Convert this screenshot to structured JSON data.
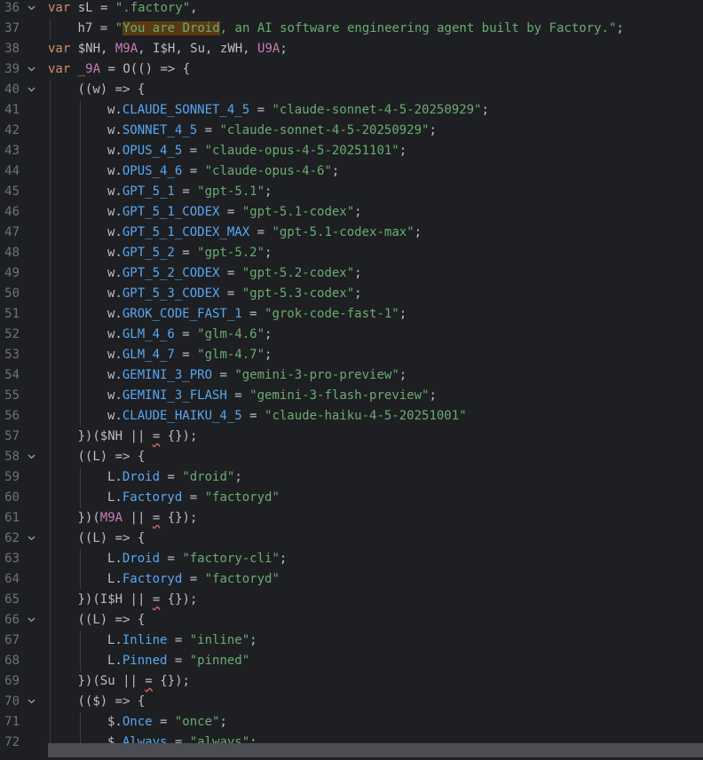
{
  "editor": {
    "language": "javascript",
    "theme_colors": {
      "background": "#1e1f22",
      "line_number": "#6f737a",
      "keyword": "#cf8e6d",
      "plain": "#bcbec4",
      "string": "#6aab73",
      "property": "#56a8f5",
      "variable": "#c77dbb",
      "search_highlight": "#5a3a11"
    },
    "lines": [
      {
        "number": "36",
        "fold": true,
        "indent": 0,
        "tokens": [
          [
            "var",
            "keyword"
          ],
          [
            " sL = ",
            "plain"
          ],
          [
            "\".factory\"",
            "string"
          ],
          [
            ",",
            "plain"
          ]
        ]
      },
      {
        "number": "37",
        "fold": false,
        "indent": 1,
        "tokens": [
          [
            "h7 = ",
            "plain"
          ],
          [
            "\"",
            "string"
          ],
          [
            "You are Droid",
            "string",
            "highlight"
          ],
          [
            ", an AI software engineering agent built by Factory.\"",
            "string"
          ],
          [
            ";",
            "plain"
          ]
        ]
      },
      {
        "number": "38",
        "fold": false,
        "indent": 0,
        "tokens": [
          [
            "var",
            "keyword"
          ],
          [
            " $NH, ",
            "plain"
          ],
          [
            "M9A",
            "var"
          ],
          [
            ", I$H, Su, zWH, ",
            "plain"
          ],
          [
            "U9A",
            "var"
          ],
          [
            ";",
            "plain"
          ]
        ]
      },
      {
        "number": "39",
        "fold": true,
        "indent": 0,
        "tokens": [
          [
            "var",
            "keyword"
          ],
          [
            " ",
            "plain"
          ],
          [
            "_9A",
            "var"
          ],
          [
            " = O(() => {",
            "plain"
          ]
        ]
      },
      {
        "number": "40",
        "fold": true,
        "indent": 1,
        "tokens": [
          [
            "((w) => {",
            "plain"
          ]
        ]
      },
      {
        "number": "41",
        "fold": false,
        "indent": 2,
        "tokens": [
          [
            "w.",
            "plain"
          ],
          [
            "CLAUDE_SONNET_4_5",
            "prop"
          ],
          [
            " = ",
            "plain"
          ],
          [
            "\"claude-sonnet-4-5-20250929\"",
            "string"
          ],
          [
            ";",
            "plain"
          ]
        ]
      },
      {
        "number": "42",
        "fold": false,
        "indent": 2,
        "tokens": [
          [
            "w.",
            "plain"
          ],
          [
            "SONNET_4_5",
            "prop"
          ],
          [
            " = ",
            "plain"
          ],
          [
            "\"claude-sonnet-4-5-20250929\"",
            "string"
          ],
          [
            ";",
            "plain"
          ]
        ]
      },
      {
        "number": "43",
        "fold": false,
        "indent": 2,
        "tokens": [
          [
            "w.",
            "plain"
          ],
          [
            "OPUS_4_5",
            "prop"
          ],
          [
            " = ",
            "plain"
          ],
          [
            "\"claude-opus-4-5-20251101\"",
            "string"
          ],
          [
            ";",
            "plain"
          ]
        ]
      },
      {
        "number": "44",
        "fold": false,
        "indent": 2,
        "tokens": [
          [
            "w.",
            "plain"
          ],
          [
            "OPUS_4_6",
            "prop"
          ],
          [
            " = ",
            "plain"
          ],
          [
            "\"claude-opus-4-6\"",
            "string"
          ],
          [
            ";",
            "plain"
          ]
        ]
      },
      {
        "number": "45",
        "fold": false,
        "indent": 2,
        "tokens": [
          [
            "w.",
            "plain"
          ],
          [
            "GPT_5_1",
            "prop"
          ],
          [
            " = ",
            "plain"
          ],
          [
            "\"gpt-5.1\"",
            "string"
          ],
          [
            ";",
            "plain"
          ]
        ]
      },
      {
        "number": "46",
        "fold": false,
        "indent": 2,
        "tokens": [
          [
            "w.",
            "plain"
          ],
          [
            "GPT_5_1_CODEX",
            "prop"
          ],
          [
            " = ",
            "plain"
          ],
          [
            "\"gpt-5.1-codex\"",
            "string"
          ],
          [
            ";",
            "plain"
          ]
        ]
      },
      {
        "number": "47",
        "fold": false,
        "indent": 2,
        "tokens": [
          [
            "w.",
            "plain"
          ],
          [
            "GPT_5_1_CODEX_MAX",
            "prop"
          ],
          [
            " = ",
            "plain"
          ],
          [
            "\"gpt-5.1-codex-max\"",
            "string"
          ],
          [
            ";",
            "plain"
          ]
        ]
      },
      {
        "number": "48",
        "fold": false,
        "indent": 2,
        "tokens": [
          [
            "w.",
            "plain"
          ],
          [
            "GPT_5_2",
            "prop"
          ],
          [
            " = ",
            "plain"
          ],
          [
            "\"gpt-5.2\"",
            "string"
          ],
          [
            ";",
            "plain"
          ]
        ]
      },
      {
        "number": "49",
        "fold": false,
        "indent": 2,
        "tokens": [
          [
            "w.",
            "plain"
          ],
          [
            "GPT_5_2_CODEX",
            "prop"
          ],
          [
            " = ",
            "plain"
          ],
          [
            "\"gpt-5.2-codex\"",
            "string"
          ],
          [
            ";",
            "plain"
          ]
        ]
      },
      {
        "number": "50",
        "fold": false,
        "indent": 2,
        "tokens": [
          [
            "w.",
            "plain"
          ],
          [
            "GPT_5_3_CODEX",
            "prop"
          ],
          [
            " = ",
            "plain"
          ],
          [
            "\"gpt-5.3-codex\"",
            "string"
          ],
          [
            ";",
            "plain"
          ]
        ]
      },
      {
        "number": "51",
        "fold": false,
        "indent": 2,
        "tokens": [
          [
            "w.",
            "plain"
          ],
          [
            "GROK_CODE_FAST_1",
            "prop"
          ],
          [
            " = ",
            "plain"
          ],
          [
            "\"grok-code-fast-1\"",
            "string"
          ],
          [
            ";",
            "plain"
          ]
        ]
      },
      {
        "number": "52",
        "fold": false,
        "indent": 2,
        "tokens": [
          [
            "w.",
            "plain"
          ],
          [
            "GLM_4_6",
            "prop"
          ],
          [
            " = ",
            "plain"
          ],
          [
            "\"glm-4.6\"",
            "string"
          ],
          [
            ";",
            "plain"
          ]
        ]
      },
      {
        "number": "53",
        "fold": false,
        "indent": 2,
        "tokens": [
          [
            "w.",
            "plain"
          ],
          [
            "GLM_4_7",
            "prop"
          ],
          [
            " = ",
            "plain"
          ],
          [
            "\"glm-4.7\"",
            "string"
          ],
          [
            ";",
            "plain"
          ]
        ]
      },
      {
        "number": "54",
        "fold": false,
        "indent": 2,
        "tokens": [
          [
            "w.",
            "plain"
          ],
          [
            "GEMINI_3_PRO",
            "prop"
          ],
          [
            " = ",
            "plain"
          ],
          [
            "\"gemini-3-pro-preview\"",
            "string"
          ],
          [
            ";",
            "plain"
          ]
        ]
      },
      {
        "number": "55",
        "fold": false,
        "indent": 2,
        "tokens": [
          [
            "w.",
            "plain"
          ],
          [
            "GEMINI_3_FLASH",
            "prop"
          ],
          [
            " = ",
            "plain"
          ],
          [
            "\"gemini-3-flash-preview\"",
            "string"
          ],
          [
            ";",
            "plain"
          ]
        ]
      },
      {
        "number": "56",
        "fold": false,
        "indent": 2,
        "tokens": [
          [
            "w.",
            "plain"
          ],
          [
            "CLAUDE_HAIKU_4_5",
            "prop"
          ],
          [
            " = ",
            "plain"
          ],
          [
            "\"claude-haiku-4-5-20251001\"",
            "string"
          ]
        ]
      },
      {
        "number": "57",
        "fold": false,
        "indent": 1,
        "tokens": [
          [
            "})($NH ",
            "plain"
          ],
          [
            "||",
            "plain"
          ],
          [
            " ",
            "plain"
          ],
          [
            "=",
            "plain",
            "squiggle"
          ],
          [
            " {});",
            "plain"
          ]
        ]
      },
      {
        "number": "58",
        "fold": true,
        "indent": 1,
        "tokens": [
          [
            "((L) => {",
            "plain"
          ]
        ]
      },
      {
        "number": "59",
        "fold": false,
        "indent": 2,
        "tokens": [
          [
            "L.",
            "plain"
          ],
          [
            "Droid",
            "prop"
          ],
          [
            " = ",
            "plain"
          ],
          [
            "\"droid\"",
            "string"
          ],
          [
            ";",
            "plain"
          ]
        ]
      },
      {
        "number": "60",
        "fold": false,
        "indent": 2,
        "tokens": [
          [
            "L.",
            "plain"
          ],
          [
            "Factoryd",
            "prop"
          ],
          [
            " = ",
            "plain"
          ],
          [
            "\"factoryd\"",
            "string"
          ]
        ]
      },
      {
        "number": "61",
        "fold": false,
        "indent": 1,
        "tokens": [
          [
            "})(",
            "plain"
          ],
          [
            "M9A",
            "var"
          ],
          [
            " ",
            "plain"
          ],
          [
            "||",
            "plain"
          ],
          [
            " ",
            "plain"
          ],
          [
            "=",
            "plain",
            "squiggle"
          ],
          [
            " {});",
            "plain"
          ]
        ]
      },
      {
        "number": "62",
        "fold": true,
        "indent": 1,
        "tokens": [
          [
            "((L) => {",
            "plain"
          ]
        ]
      },
      {
        "number": "63",
        "fold": false,
        "indent": 2,
        "tokens": [
          [
            "L.",
            "plain"
          ],
          [
            "Droid",
            "prop"
          ],
          [
            " = ",
            "plain"
          ],
          [
            "\"factory-cli\"",
            "string"
          ],
          [
            ";",
            "plain"
          ]
        ]
      },
      {
        "number": "64",
        "fold": false,
        "indent": 2,
        "tokens": [
          [
            "L.",
            "plain"
          ],
          [
            "Factoryd",
            "prop"
          ],
          [
            " = ",
            "plain"
          ],
          [
            "\"factoryd\"",
            "string"
          ]
        ]
      },
      {
        "number": "65",
        "fold": false,
        "indent": 1,
        "tokens": [
          [
            "})(I$H ",
            "plain"
          ],
          [
            "||",
            "plain"
          ],
          [
            " ",
            "plain"
          ],
          [
            "=",
            "plain",
            "squiggle"
          ],
          [
            " {});",
            "plain"
          ]
        ]
      },
      {
        "number": "66",
        "fold": true,
        "indent": 1,
        "tokens": [
          [
            "((L) => {",
            "plain"
          ]
        ]
      },
      {
        "number": "67",
        "fold": false,
        "indent": 2,
        "tokens": [
          [
            "L.",
            "plain"
          ],
          [
            "Inline",
            "prop"
          ],
          [
            " = ",
            "plain"
          ],
          [
            "\"inline\"",
            "string"
          ],
          [
            ";",
            "plain"
          ]
        ]
      },
      {
        "number": "68",
        "fold": false,
        "indent": 2,
        "tokens": [
          [
            "L.",
            "plain"
          ],
          [
            "Pinned",
            "prop"
          ],
          [
            " = ",
            "plain"
          ],
          [
            "\"pinned\"",
            "string"
          ]
        ]
      },
      {
        "number": "69",
        "fold": false,
        "indent": 1,
        "tokens": [
          [
            "})(Su ",
            "plain"
          ],
          [
            "||",
            "plain"
          ],
          [
            " ",
            "plain"
          ],
          [
            "=",
            "plain",
            "squiggle"
          ],
          [
            " {});",
            "plain"
          ]
        ]
      },
      {
        "number": "70",
        "fold": true,
        "indent": 1,
        "tokens": [
          [
            "(($) => {",
            "plain"
          ]
        ]
      },
      {
        "number": "71",
        "fold": false,
        "indent": 2,
        "tokens": [
          [
            "$.",
            "plain"
          ],
          [
            "Once",
            "prop"
          ],
          [
            " = ",
            "plain"
          ],
          [
            "\"once\"",
            "string"
          ],
          [
            ";",
            "plain"
          ]
        ]
      },
      {
        "number": "72",
        "fold": false,
        "indent": 2,
        "tokens": [
          [
            "$.",
            "plain"
          ],
          [
            "Always",
            "prop"
          ],
          [
            " = ",
            "plain"
          ],
          [
            "\"always\"",
            "string"
          ],
          [
            ";",
            "plain"
          ]
        ]
      }
    ]
  }
}
